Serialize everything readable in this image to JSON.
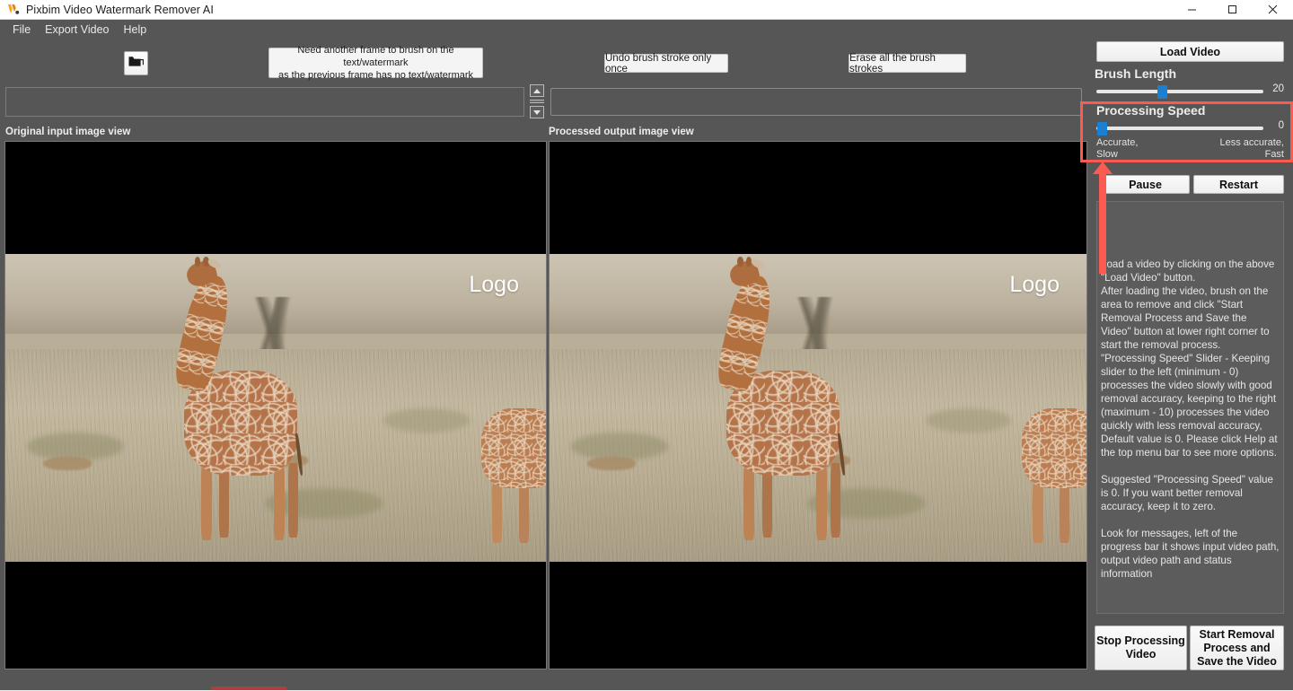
{
  "window": {
    "title": "Pixbim Video Watermark Remover AI",
    "logo_icon": "pixbim-logo-icon",
    "controls": {
      "minimize": "—",
      "maximize": "❐",
      "close": "✕"
    }
  },
  "menu": {
    "items": [
      {
        "label": "File"
      },
      {
        "label": "Export Video"
      },
      {
        "label": "Help"
      }
    ]
  },
  "toolbar": {
    "open_icon": "open-folder-icon",
    "hint_line1": "Need another frame to brush on the text/watermark",
    "hint_line2": "as the previous frame has no text/watermark",
    "undo_label": "Undo brush stroke only once",
    "erase_label": "Erase all the brush strokes"
  },
  "status_row": {
    "message_value": "",
    "message_placeholder": "",
    "spinner_up_icon": "spinner-up-arrow-icon",
    "spinner_down_icon": "spinner-down-arrow-icon",
    "progress_value": ""
  },
  "views": {
    "original_label": "Original input image view",
    "processed_label": "Processed output image view",
    "watermark_text": "Logo"
  },
  "sidebar": {
    "load_video_label": "Load Video",
    "brush_length": {
      "title": "Brush Length",
      "value": "20",
      "min": 0,
      "max": 50,
      "thumb_percent": 38
    },
    "processing_speed": {
      "title": "Processing Speed",
      "value": "0",
      "min": 0,
      "max": 10,
      "thumb_percent": 0,
      "legend_left_line1": "Accurate,",
      "legend_left_line2": "Slow",
      "legend_right_line1": "Less accurate,",
      "legend_right_line2": "Fast"
    },
    "pause_label": "Pause",
    "restart_label": "Restart",
    "help_text": "Load a video by clicking on the above \"Load Video\" button.\nAfter loading the video, brush on the area to remove and click \"Start Removal Process and Save the Video\" button at lower right corner to start the removal process.\n\"Processing Speed\" Slider - Keeping slider to the left (minimum - 0) processes the video slowly with good removal accuracy, keeping to the right (maximum - 10) processes the video quickly with less removal accuracy, Default value is 0. Please click Help at the top menu bar to see more options.\n\nSuggested \"Processing Speed\" value is 0. If you want better removal accuracy, keep it to zero.\n\nLook for messages, left of the progress bar it shows input video path, output video path and status information",
    "stop_label": "Stop Processing Video",
    "start_label": "Start Removal Process and Save the Video"
  },
  "annotation": {
    "color": "#fc5b52",
    "highlight_target": "Processing Speed",
    "arrow_icon": "red-up-arrow-icon"
  },
  "colors": {
    "window_chrome": "#565656",
    "titlebar": "#ffffff",
    "slider_thumb": "#1b7fd4",
    "annotation_red": "#fc5b52",
    "button_face": "#f4f4f4"
  }
}
